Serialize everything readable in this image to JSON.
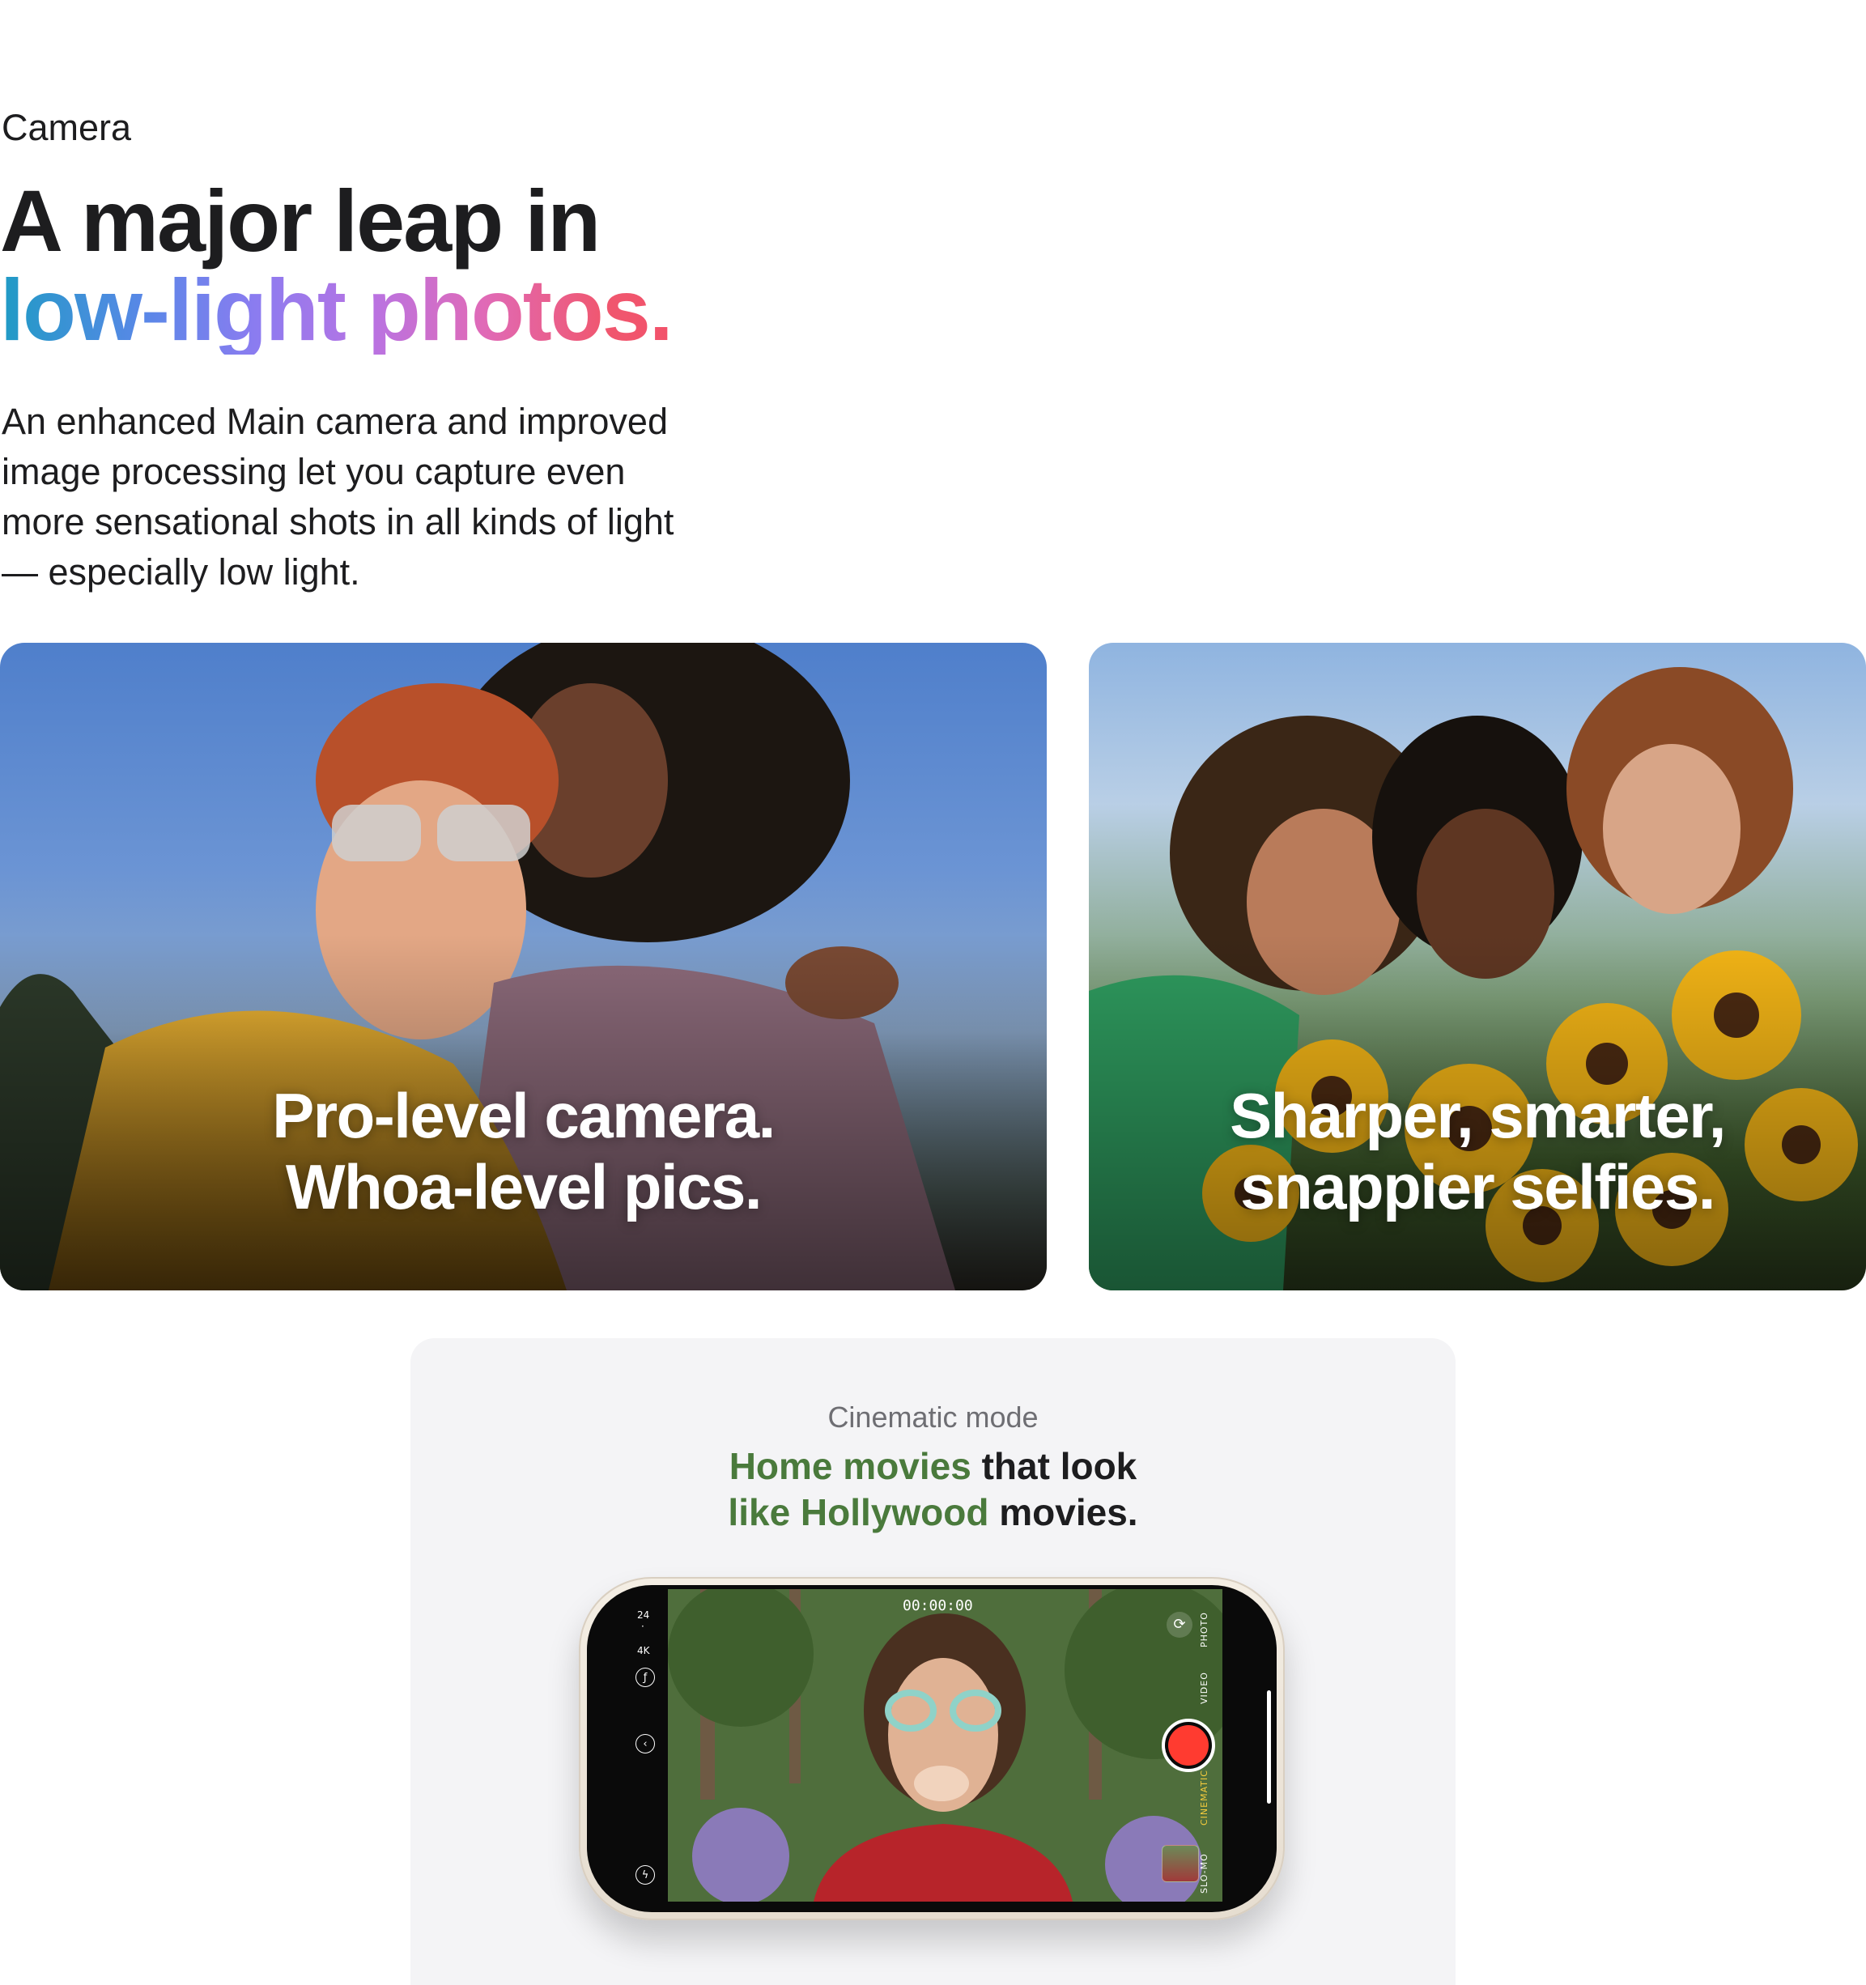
{
  "section": {
    "eyebrow": "Camera",
    "headline_line1": "A major leap in",
    "headline_line2": "low-light photos.",
    "intro": "An enhanced Main camera and improved image processing let you capture even more sensational shots in all kinds of light — especially low light."
  },
  "tiles": [
    {
      "caption_line1": "Pro-level camera.",
      "caption_line2": "Whoa-level pics."
    },
    {
      "caption_line1": "Sharper, smarter,",
      "caption_line2": "snappier selfies."
    }
  ],
  "cinematic": {
    "eyebrow": "Cinematic mode",
    "headline_green_1": "Home movies",
    "headline_plain_1": " that look",
    "headline_green_2": "like Hollywood",
    "headline_plain_2": " movies."
  },
  "phone_ui": {
    "timer": "00:00:00",
    "frame_rate": "24",
    "separator": "·",
    "resolution": "4K",
    "modes": [
      "SLO-MO",
      "CINEMATIC",
      "VIDEO",
      "PHOTO"
    ],
    "active_mode": "CINEMATIC",
    "shutter_color": "#ff3b30",
    "active_mode_color": "#f5cb3c"
  },
  "colors": {
    "headline_gradient": [
      "#1f9bc5",
      "#8b7cf0",
      "#e06ab7",
      "#f2526a"
    ],
    "cinematic_accent": "#4a7a3c"
  }
}
